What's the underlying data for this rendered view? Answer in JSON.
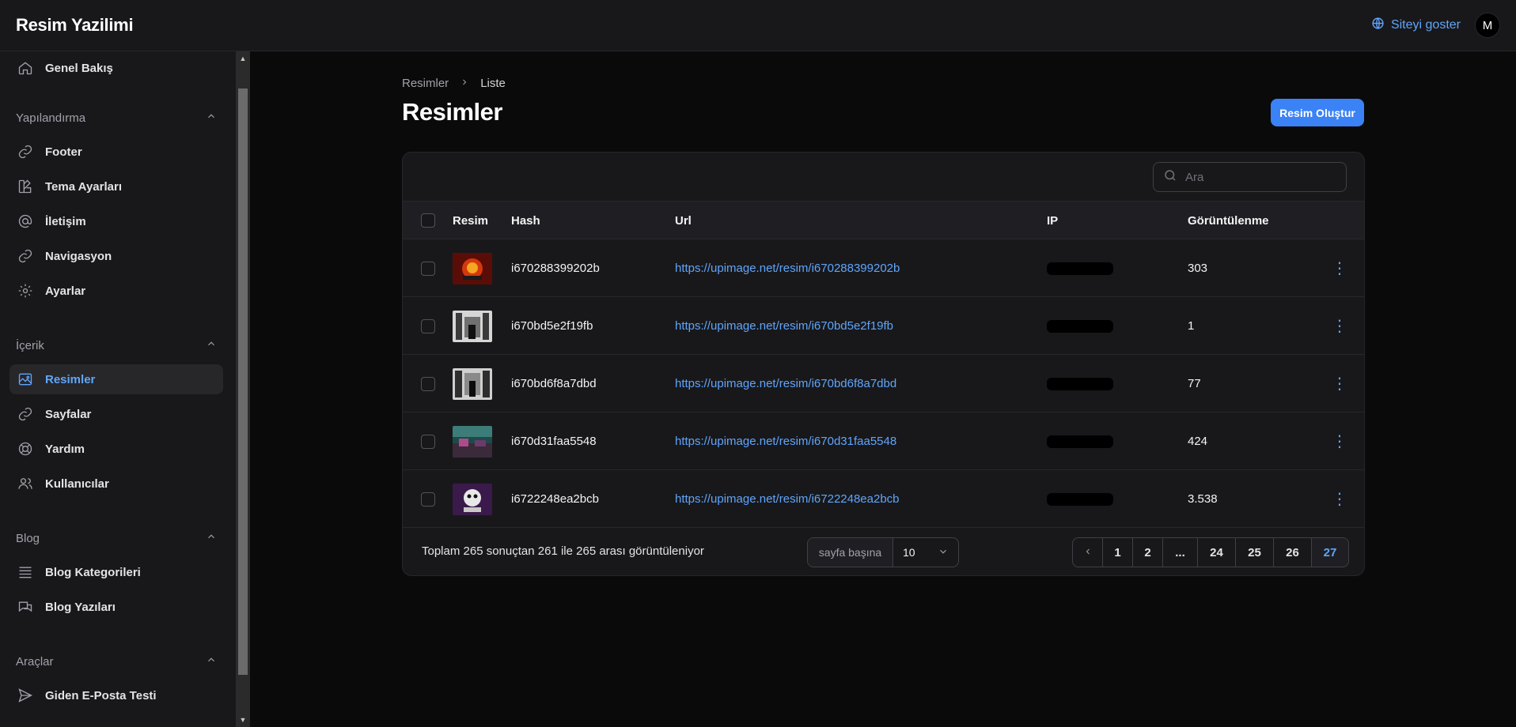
{
  "app": {
    "title": "Resim Yazilimi"
  },
  "topbar": {
    "site_link": "Siteyi goster",
    "avatar_initial": "M"
  },
  "sidebar": {
    "overview": "Genel Bakış",
    "groups": [
      {
        "label": "Yapılandırma",
        "items": [
          "Footer",
          "Tema Ayarları",
          "İletişim",
          "Navigasyon",
          "Ayarlar"
        ]
      },
      {
        "label": "İçerik",
        "items": [
          "Resimler",
          "Sayfalar",
          "Yardım",
          "Kullanıcılar"
        ]
      },
      {
        "label": "Blog",
        "items": [
          "Blog Kategorileri",
          "Blog Yazıları"
        ]
      },
      {
        "label": "Araçlar",
        "items": [
          "Giden E-Posta Testi"
        ]
      }
    ],
    "active_item": "Resimler"
  },
  "header": {
    "breadcrumb": [
      "Resimler",
      "Liste"
    ],
    "title": "Resimler",
    "create_button": "Resim Oluştur"
  },
  "table": {
    "search_placeholder": "Ara",
    "columns": [
      "Resim",
      "Hash",
      "Url",
      "IP",
      "Görüntülenme"
    ],
    "rows": [
      {
        "hash": "i670288399202b",
        "url": "https://upimage.net/resim/i670288399202b",
        "views": "303"
      },
      {
        "hash": "i670bd5e2f19fb",
        "url": "https://upimage.net/resim/i670bd5e2f19fb",
        "views": "1"
      },
      {
        "hash": "i670bd6f8a7dbd",
        "url": "https://upimage.net/resim/i670bd6f8a7dbd",
        "views": "77"
      },
      {
        "hash": "i670d31faa5548",
        "url": "https://upimage.net/resim/i670d31faa5548",
        "views": "424"
      },
      {
        "hash": "i6722248ea2bcb",
        "url": "https://upimage.net/resim/i6722248ea2bcb",
        "views": "3.538"
      }
    ]
  },
  "pagination": {
    "summary": "Toplam 265 sonuçtan 261 ile 265 arası görüntüleniyor",
    "per_page_label": "sayfa başına",
    "per_page_value": "10",
    "pages": [
      "1",
      "2",
      "...",
      "24",
      "25",
      "26",
      "27"
    ],
    "current_page": "27"
  },
  "colors": {
    "accent": "#3b82f6",
    "link": "#60a5fa",
    "background": "#0a0a0b",
    "panel": "#18181b"
  }
}
